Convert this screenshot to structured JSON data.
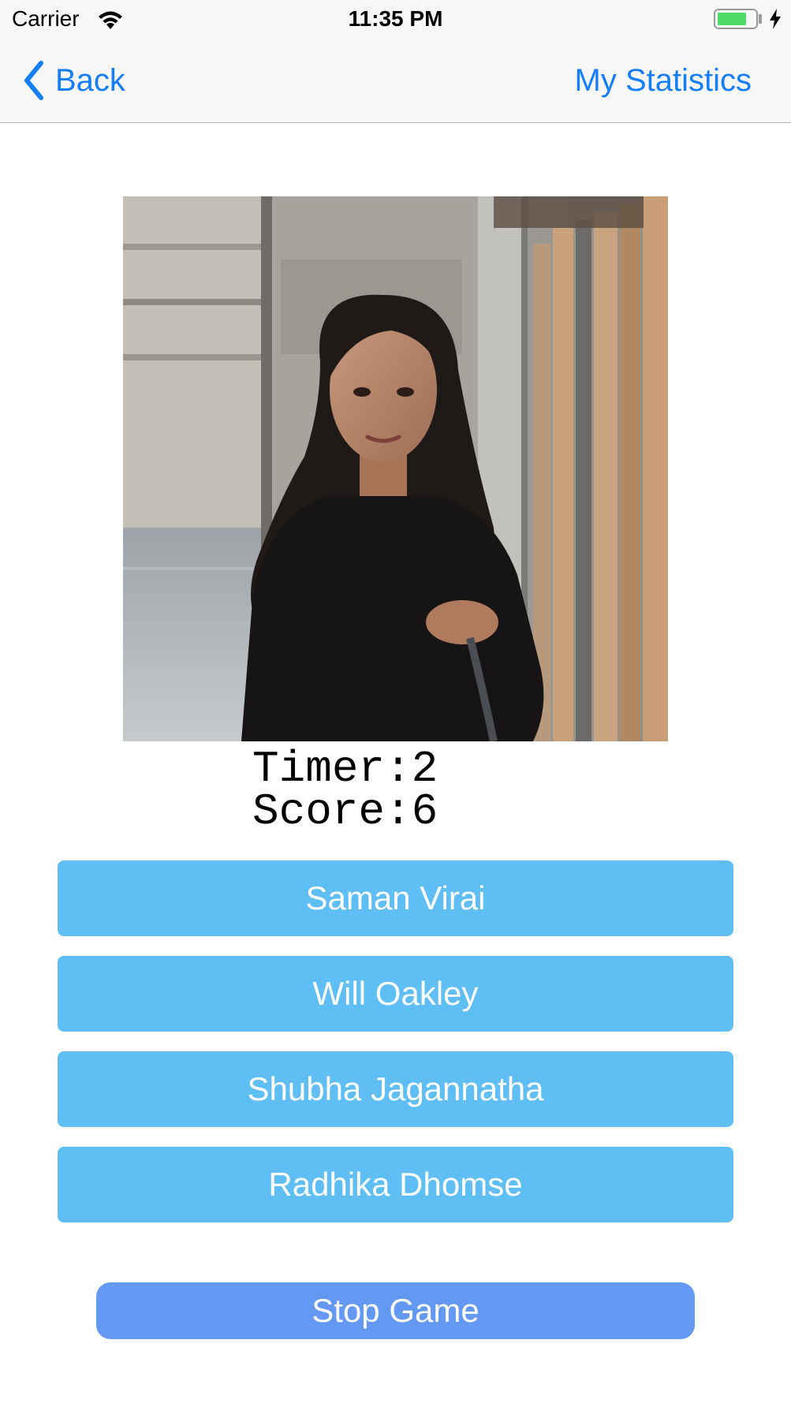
{
  "status_bar": {
    "carrier": "Carrier",
    "time": "11:35 PM",
    "battery_level": 0.78,
    "charging": true,
    "wifi_icon": "wifi-icon",
    "battery_color": "#4cd964"
  },
  "nav": {
    "back_label": "Back",
    "stats_label": "My Statistics",
    "tint_color": "#147efb"
  },
  "game": {
    "timer_text": "Timer:2",
    "score_text": "Score:6",
    "photo_icon": "person-photo"
  },
  "answers": [
    {
      "label": "Saman Virai"
    },
    {
      "label": "Will Oakley"
    },
    {
      "label": "Shubha Jagannatha"
    },
    {
      "label": "Radhika Dhomse"
    }
  ],
  "stop_label": "Stop Game",
  "colors": {
    "answer_button": "#5fbff5",
    "stop_button": "#6398f3"
  }
}
